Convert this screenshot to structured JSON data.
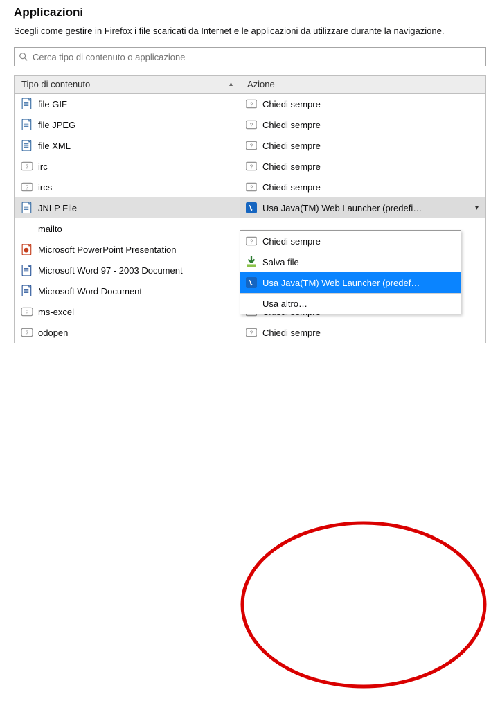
{
  "title": "Applicazioni",
  "description": "Scegli come gestire in Firefox i file scaricati da Internet e le applicazioni da utilizzare durante la navigazione.",
  "search": {
    "placeholder": "Cerca tipo di contenuto o applicazione"
  },
  "columns": {
    "type": "Tipo di contenuto",
    "action": "Azione",
    "sort_indicator": "▴"
  },
  "rows": [
    {
      "type": "file GIF",
      "icon": "file-gif",
      "action": "Chiedi sempre",
      "action_icon": "ask"
    },
    {
      "type": "file JPEG",
      "icon": "file-jpeg",
      "action": "Chiedi sempre",
      "action_icon": "ask"
    },
    {
      "type": "file XML",
      "icon": "file-xml",
      "action": "Chiedi sempre",
      "action_icon": "ask"
    },
    {
      "type": "irc",
      "icon": "protocol",
      "action": "Chiedi sempre",
      "action_icon": "ask"
    },
    {
      "type": "ircs",
      "icon": "protocol",
      "action": "Chiedi sempre",
      "action_icon": "ask"
    },
    {
      "type": "JNLP File",
      "icon": "file-jnlp",
      "action": "Usa Java(TM) Web Launcher (predefi…",
      "action_icon": "java",
      "selected": true
    },
    {
      "type": "mailto",
      "icon": "none",
      "action": "",
      "action_icon": "none"
    },
    {
      "type": "Microsoft PowerPoint Presentation",
      "icon": "ppt",
      "action": "",
      "action_icon": "none"
    },
    {
      "type": "Microsoft Word 97 - 2003 Document",
      "icon": "doc",
      "action": "",
      "action_icon": "none"
    },
    {
      "type": "Microsoft Word Document",
      "icon": "docx",
      "action": "",
      "action_icon": "none"
    },
    {
      "type": "ms-excel",
      "icon": "protocol",
      "action": "Chiedi sempre",
      "action_icon": "ask"
    },
    {
      "type": "odopen",
      "icon": "protocol",
      "action": "Chiedi sempre",
      "action_icon": "ask"
    }
  ],
  "dropdown": {
    "items": [
      {
        "label": "Chiedi sempre",
        "icon": "ask"
      },
      {
        "label": "Salva file",
        "icon": "save"
      },
      {
        "label": "Usa Java(TM) Web Launcher (predef…",
        "icon": "java",
        "highlighted": true
      },
      {
        "label": "Usa altro…",
        "icon": "none",
        "separator": true
      }
    ]
  },
  "annotation_color": "#d90000"
}
